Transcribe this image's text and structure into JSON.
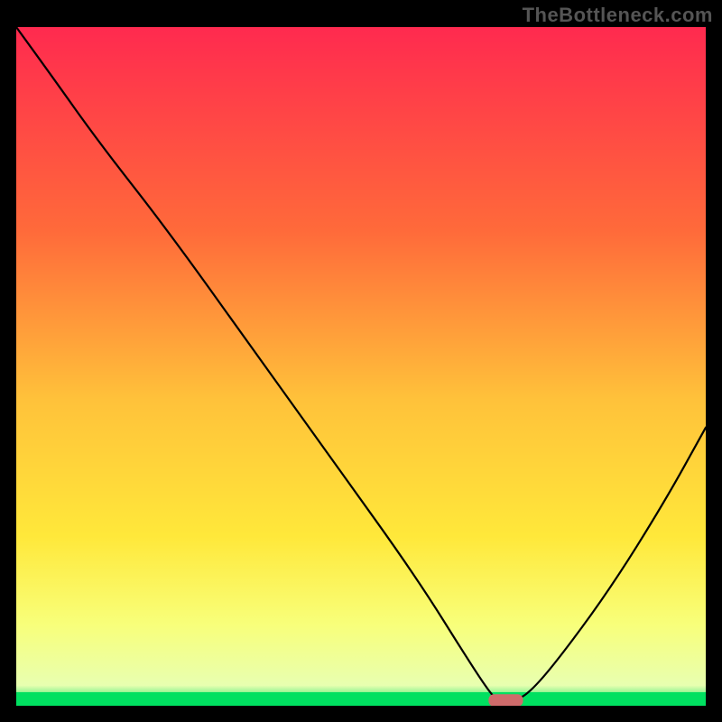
{
  "watermark": "TheBottleneck.com",
  "chart_data": {
    "type": "line",
    "title": "",
    "xlabel": "",
    "ylabel": "",
    "xlim": [
      0,
      100
    ],
    "ylim": [
      0,
      100
    ],
    "grid": false,
    "legend": false,
    "background": {
      "main_gradient_stops": [
        {
          "offset": 0,
          "color": "#ff2a4f"
        },
        {
          "offset": 30,
          "color": "#ff6a3a"
        },
        {
          "offset": 55,
          "color": "#ffc23a"
        },
        {
          "offset": 75,
          "color": "#ffe83a"
        },
        {
          "offset": 88,
          "color": "#f8ff7a"
        },
        {
          "offset": 97,
          "color": "#e8ffb0"
        },
        {
          "offset": 100,
          "color": "#00e060"
        }
      ],
      "bottom_green_band_pct": 2.0
    },
    "curve": {
      "x": [
        0,
        5,
        12,
        22,
        34,
        46,
        58,
        66,
        69,
        70,
        72,
        74,
        78,
        86,
        94,
        100
      ],
      "y": [
        100,
        93,
        83,
        70,
        53,
        36,
        19,
        6,
        1.5,
        0.8,
        0.8,
        1.5,
        6,
        17,
        30,
        41
      ]
    },
    "marker": {
      "x": 71,
      "y": 0.8,
      "color": "#cf6b6b",
      "width_pct": 5.0,
      "height_pct": 1.8
    }
  }
}
